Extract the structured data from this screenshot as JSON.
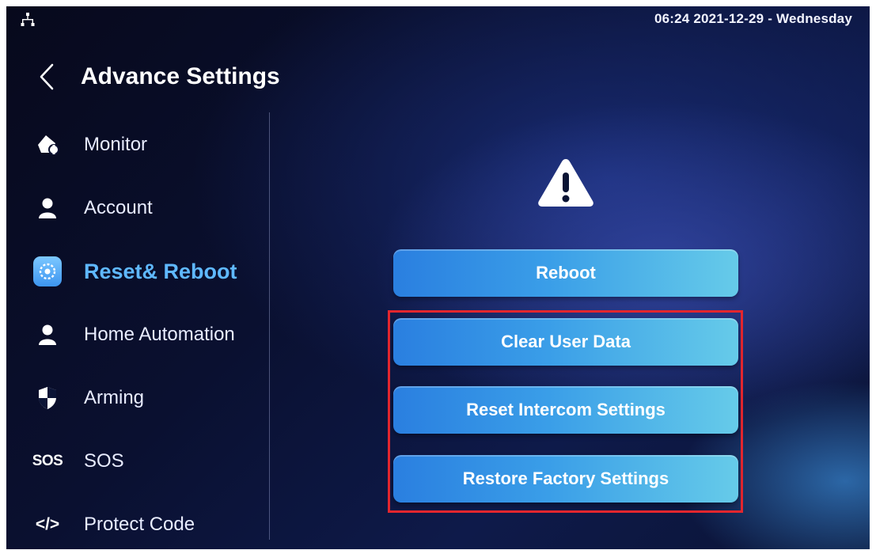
{
  "status_bar": {
    "network_icon": "network-icon",
    "datetime": "06:24  2021-12-29 - Wednesday"
  },
  "header": {
    "back_icon": "chevron-left-icon",
    "title": "Advance Settings"
  },
  "sidebar": {
    "items": [
      {
        "label": "Monitor",
        "icon": "monitor-icon",
        "active": false
      },
      {
        "label": "Account",
        "icon": "person-icon",
        "active": false
      },
      {
        "label": "Reset& Reboot",
        "icon": "reset-icon",
        "active": true
      },
      {
        "label": "Home Automation",
        "icon": "person-icon",
        "active": false
      },
      {
        "label": "Arming",
        "icon": "shield-icon",
        "active": false
      },
      {
        "label": "SOS",
        "icon": "sos-icon",
        "icon_text": "SOS",
        "active": false
      },
      {
        "label": "Protect Code",
        "icon": "code-icon",
        "icon_text": "</>",
        "active": false
      }
    ]
  },
  "main": {
    "warning_icon": "warning-icon",
    "buttons": {
      "reboot": "Reboot",
      "clear_user_data": "Clear User Data",
      "reset_intercom": "Reset Intercom Settings",
      "restore_factory": "Restore Factory Settings"
    }
  },
  "colors": {
    "active_accent": "#5fb8ff",
    "button_start": "#2a7fe0",
    "button_end": "#66cbe9",
    "highlight_border": "#e3262e"
  }
}
